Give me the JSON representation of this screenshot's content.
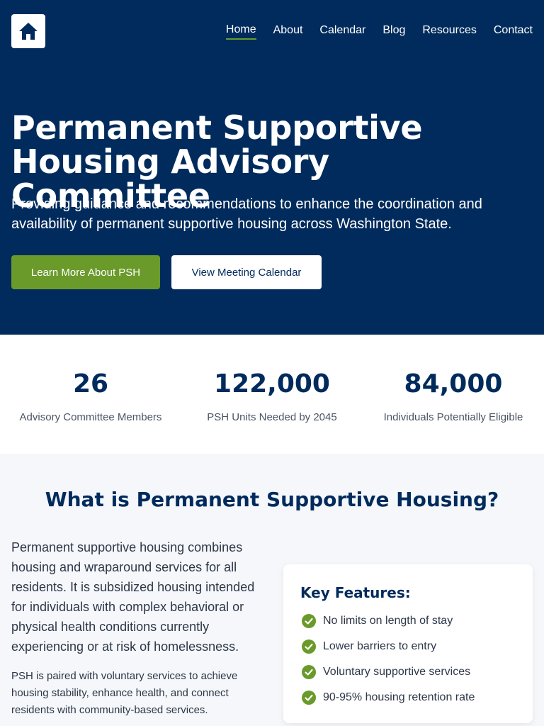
{
  "header": {
    "logo_icon": "home-icon",
    "nav": [
      {
        "label": "Home",
        "active": true
      },
      {
        "label": "About"
      },
      {
        "label": "Calendar"
      },
      {
        "label": "Blog"
      },
      {
        "label": "Resources"
      },
      {
        "label": "Contact"
      }
    ]
  },
  "hero": {
    "title": "Permanent Supportive Housing Advisory Committee",
    "subtitle": "Providing guidance and recommendations to enhance the coordination and availability of permanent supportive housing across Washington State.",
    "primary_button": "Learn More About PSH",
    "secondary_button": "View Meeting Calendar"
  },
  "stats": [
    {
      "value": "26",
      "label": "Advisory Committee Members"
    },
    {
      "value": "122,000",
      "label": "PSH Units Needed by 2045"
    },
    {
      "value": "84,000",
      "label": "Individuals Potentially Eligible"
    }
  ],
  "about": {
    "heading": "What is Permanent Supportive Housing?",
    "paragraph1": "Permanent supportive housing combines housing and wraparound services for all residents. It is subsidized housing intended for individuals with complex behavioral or physical health conditions currently experiencing or at risk of homelessness.",
    "paragraph2": "PSH is paired with voluntary services to achieve housing stability, enhance health, and connect residents with community-based services.",
    "features_title": "Key Features:",
    "features": [
      "No limits on length of stay",
      "Lower barriers to entry",
      "Voluntary supportive services",
      "90-95% housing retention rate"
    ]
  },
  "colors": {
    "navy": "#002b5c",
    "green": "#6a9a2a"
  }
}
